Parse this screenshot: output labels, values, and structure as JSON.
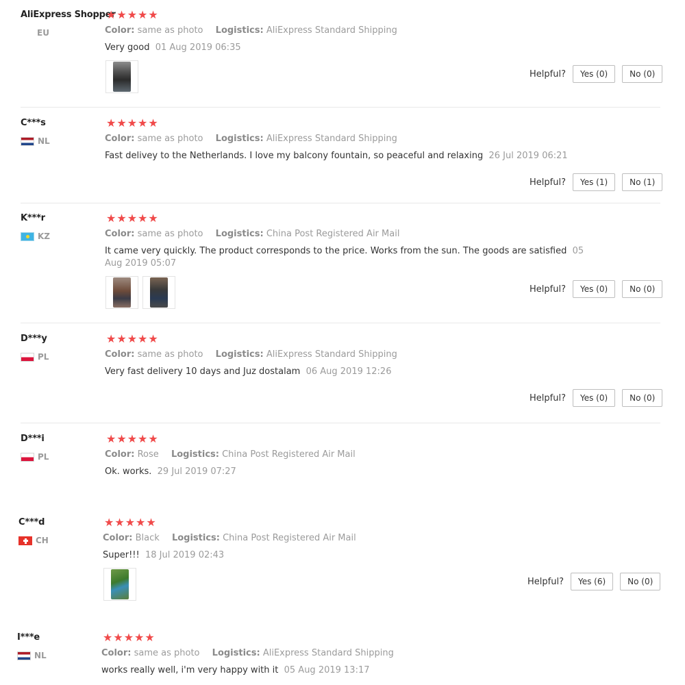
{
  "helpful_label": "Helpful?",
  "star_glyph": "★",
  "labels": {
    "color": "Color:",
    "logistics": "Logistics:"
  },
  "colors": {
    "star": "#f04a4a",
    "divider": "#e8e8e8",
    "meta_text": "#9b9b9b"
  },
  "reviews": [
    {
      "user": "AliExpress Shopper",
      "country": "EU",
      "flag": "none",
      "rating": 5,
      "color": "same as photo",
      "logistics": "AliExpress Standard Shipping",
      "text": "Very good",
      "date": "01 Aug 2019 06:35",
      "photos": [
        "photo-thumbnail"
      ],
      "yes": "Yes (0)",
      "no": "No (0)"
    },
    {
      "user": "C***s",
      "country": "NL",
      "flag": "nl",
      "rating": 5,
      "color": "same as photo",
      "logistics": "AliExpress Standard Shipping",
      "text": "Fast delivey to the Netherlands. I love my balcony fountain, so peaceful and relaxing",
      "date": "26 Jul 2019 06:21",
      "photos": [],
      "yes": "Yes (1)",
      "no": "No (1)"
    },
    {
      "user": "K***r",
      "country": "KZ",
      "flag": "kz",
      "rating": 5,
      "color": "same as photo",
      "logistics": "China Post Registered Air Mail",
      "text": "It came very quickly. The product corresponds to the price. Works from the sun. The goods are satisfied",
      "date": "05 Aug 2019 05:07",
      "photos": [
        "photo-thumbnail",
        "photo-thumbnail"
      ],
      "yes": "Yes (0)",
      "no": "No (0)"
    },
    {
      "user": "D***y",
      "country": "PL",
      "flag": "pl",
      "rating": 5,
      "color": "same as photo",
      "logistics": "AliExpress Standard Shipping",
      "text": "Very fast delivery 10 days and Juz dostalam",
      "date": "06 Aug 2019 12:26",
      "photos": [],
      "yes": "Yes (0)",
      "no": "No (0)"
    },
    {
      "user": "D***i",
      "country": "PL",
      "flag": "pl",
      "rating": 5,
      "color": "Rose",
      "logistics": "China Post Registered Air Mail",
      "text": "Ok. works.",
      "date": "29 Jul 2019 07:27",
      "photos": []
    },
    {
      "user": "C***d",
      "country": "CH",
      "flag": "ch",
      "rating": 5,
      "color": "Black",
      "logistics": "China Post Registered Air Mail",
      "text": "Super!!!",
      "date": "18 Jul 2019 02:43",
      "photos": [
        "photo-thumbnail"
      ],
      "yes": "Yes (6)",
      "no": "No (0)"
    },
    {
      "user": "I***e",
      "country": "NL",
      "flag": "nl",
      "rating": 5,
      "color": "same as photo",
      "logistics": "AliExpress Standard Shipping",
      "text": "works really well, i'm very happy with it",
      "date": "05 Aug 2019 13:17",
      "photos": []
    }
  ]
}
